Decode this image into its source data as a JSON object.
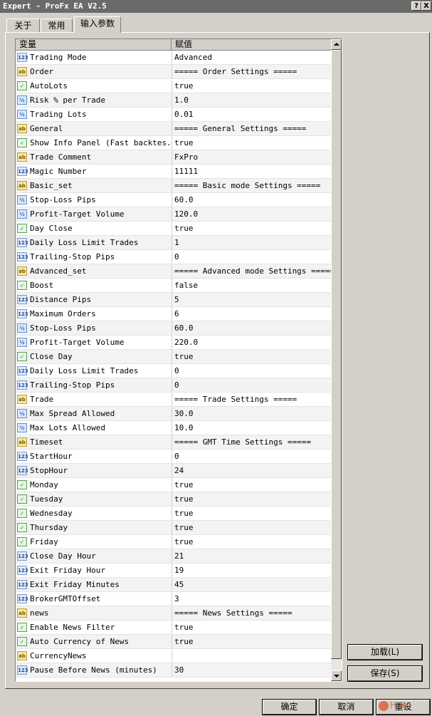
{
  "window": {
    "title": "Expert - ProFx EA V2.5",
    "help_glyph": "?",
    "close_glyph": "X"
  },
  "tabs": [
    {
      "label": "关于"
    },
    {
      "label": "常用"
    },
    {
      "label": "输入参数",
      "active": true
    }
  ],
  "table": {
    "columns": [
      "变量",
      "赋值"
    ],
    "rows": [
      {
        "icon": "int",
        "name": "Trading Mode",
        "value": "Advanced"
      },
      {
        "icon": "string",
        "name": "Order",
        "value": "===== Order Settings ====="
      },
      {
        "icon": "bool",
        "name": "AutoLots",
        "value": "true"
      },
      {
        "icon": "double",
        "name": "Risk % per Trade",
        "value": "1.0"
      },
      {
        "icon": "double",
        "name": "Trading Lots",
        "value": "0.01"
      },
      {
        "icon": "string",
        "name": "General",
        "value": "===== General Settings ====="
      },
      {
        "icon": "bool",
        "name": "Show Info Panel (Fast backtes...",
        "value": "true"
      },
      {
        "icon": "string",
        "name": "Trade Comment",
        "value": "FxPro"
      },
      {
        "icon": "int",
        "name": "Magic Number",
        "value": "11111"
      },
      {
        "icon": "string",
        "name": "Basic_set",
        "value": "===== Basic mode Settings ====="
      },
      {
        "icon": "double",
        "name": "Stop-Loss Pips",
        "value": "60.0"
      },
      {
        "icon": "double",
        "name": "Profit-Target Volume",
        "value": "120.0"
      },
      {
        "icon": "bool",
        "name": "Day Close",
        "value": "true"
      },
      {
        "icon": "int",
        "name": "Daily Loss Limit Trades",
        "value": "1"
      },
      {
        "icon": "int",
        "name": "Trailing-Stop Pips",
        "value": "0"
      },
      {
        "icon": "string",
        "name": "Advanced_set",
        "value": "===== Advanced mode Settings ====="
      },
      {
        "icon": "bool",
        "name": "Boost",
        "value": "false"
      },
      {
        "icon": "int",
        "name": "Distance Pips",
        "value": "5"
      },
      {
        "icon": "int",
        "name": "Maximum Orders",
        "value": "6"
      },
      {
        "icon": "double",
        "name": "Stop-Loss Pips",
        "value": "60.0"
      },
      {
        "icon": "double",
        "name": "Profit-Target Volume",
        "value": "220.0"
      },
      {
        "icon": "bool",
        "name": "Close Day",
        "value": "true"
      },
      {
        "icon": "int",
        "name": "Daily Loss Limit Trades",
        "value": "0"
      },
      {
        "icon": "int",
        "name": "Trailing-Stop Pips",
        "value": "0"
      },
      {
        "icon": "string",
        "name": "Trade",
        "value": "===== Trade Settings ====="
      },
      {
        "icon": "double",
        "name": "Max Spread Allowed",
        "value": "30.0"
      },
      {
        "icon": "double",
        "name": "Max Lots Allowed",
        "value": "10.0"
      },
      {
        "icon": "string",
        "name": "Timeset",
        "value": "===== GMT Time Settings ====="
      },
      {
        "icon": "int",
        "name": "StartHour",
        "value": "0"
      },
      {
        "icon": "int",
        "name": "StopHour",
        "value": "24"
      },
      {
        "icon": "bool",
        "name": "Monday",
        "value": "true"
      },
      {
        "icon": "bool",
        "name": "Tuesday",
        "value": "true"
      },
      {
        "icon": "bool",
        "name": "Wednesday",
        "value": "true"
      },
      {
        "icon": "bool",
        "name": "Thursday",
        "value": "true"
      },
      {
        "icon": "bool",
        "name": "Friday",
        "value": "true"
      },
      {
        "icon": "int",
        "name": "Close Day Hour",
        "value": "21"
      },
      {
        "icon": "int",
        "name": "Exit Friday Hour",
        "value": "19"
      },
      {
        "icon": "int",
        "name": "Exit Friday Minutes",
        "value": "45"
      },
      {
        "icon": "int",
        "name": "BrokerGMTOffset",
        "value": "3"
      },
      {
        "icon": "string",
        "name": "news",
        "value": "===== News Settings ====="
      },
      {
        "icon": "bool",
        "name": "Enable News Filter",
        "value": "true"
      },
      {
        "icon": "bool",
        "name": "Auto Currency of News",
        "value": "true"
      },
      {
        "icon": "string",
        "name": "CurrencyNews",
        "value": ""
      },
      {
        "icon": "int",
        "name": "Pause Before News (minutes)",
        "value": "30"
      }
    ]
  },
  "icon_glyphs": {
    "int": "123",
    "string": "ab",
    "bool": "✓",
    "double": "½"
  },
  "side_buttons": {
    "load": "加载(L)",
    "save": "保存(S)"
  },
  "footer_buttons": {
    "ok": "确定",
    "cancel": "取消",
    "reset": "重设"
  },
  "watermark": {
    "text": "Hub"
  }
}
